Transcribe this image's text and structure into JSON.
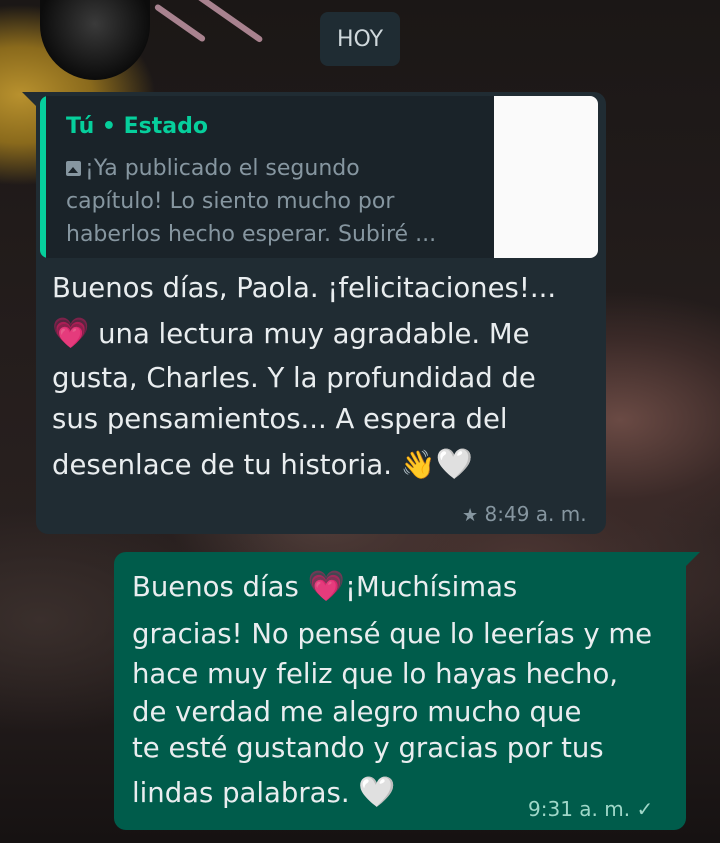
{
  "date_chip": "HOY",
  "incoming": {
    "quote": {
      "author": "Tú • Estado",
      "lines": [
        "¡Ya publicado el segundo",
        "capítulo! Lo siento mucho por",
        "haberlos hecho esperar. Subiré ..."
      ]
    },
    "lines": [
      "Buenos días, Paola. ¡felicitaciones!...",
      "una lectura muy agradable. Me",
      "gusta, Charles. Y la profundidad de",
      "sus pensamientos... A espera del",
      "desenlace de tu historia."
    ],
    "emoji": {
      "pink_heart": "💗",
      "waving_hand": "👋",
      "white_heart": "🤍"
    },
    "time": "8:49 a. m.",
    "starred": true
  },
  "outgoing": {
    "lines": [
      "Buenos días",
      "¡Muchísimas",
      "gracias! No pensé que lo leerías y me",
      "hace muy feliz que lo hayas hecho,",
      "de verdad me alegro mucho que",
      "te esté gustando y gracias por tus",
      "lindas palabras."
    ],
    "emoji": {
      "pink_heart": "💗",
      "white_heart": "🤍"
    },
    "time": "9:31 a. m.",
    "status": "sent-check"
  }
}
